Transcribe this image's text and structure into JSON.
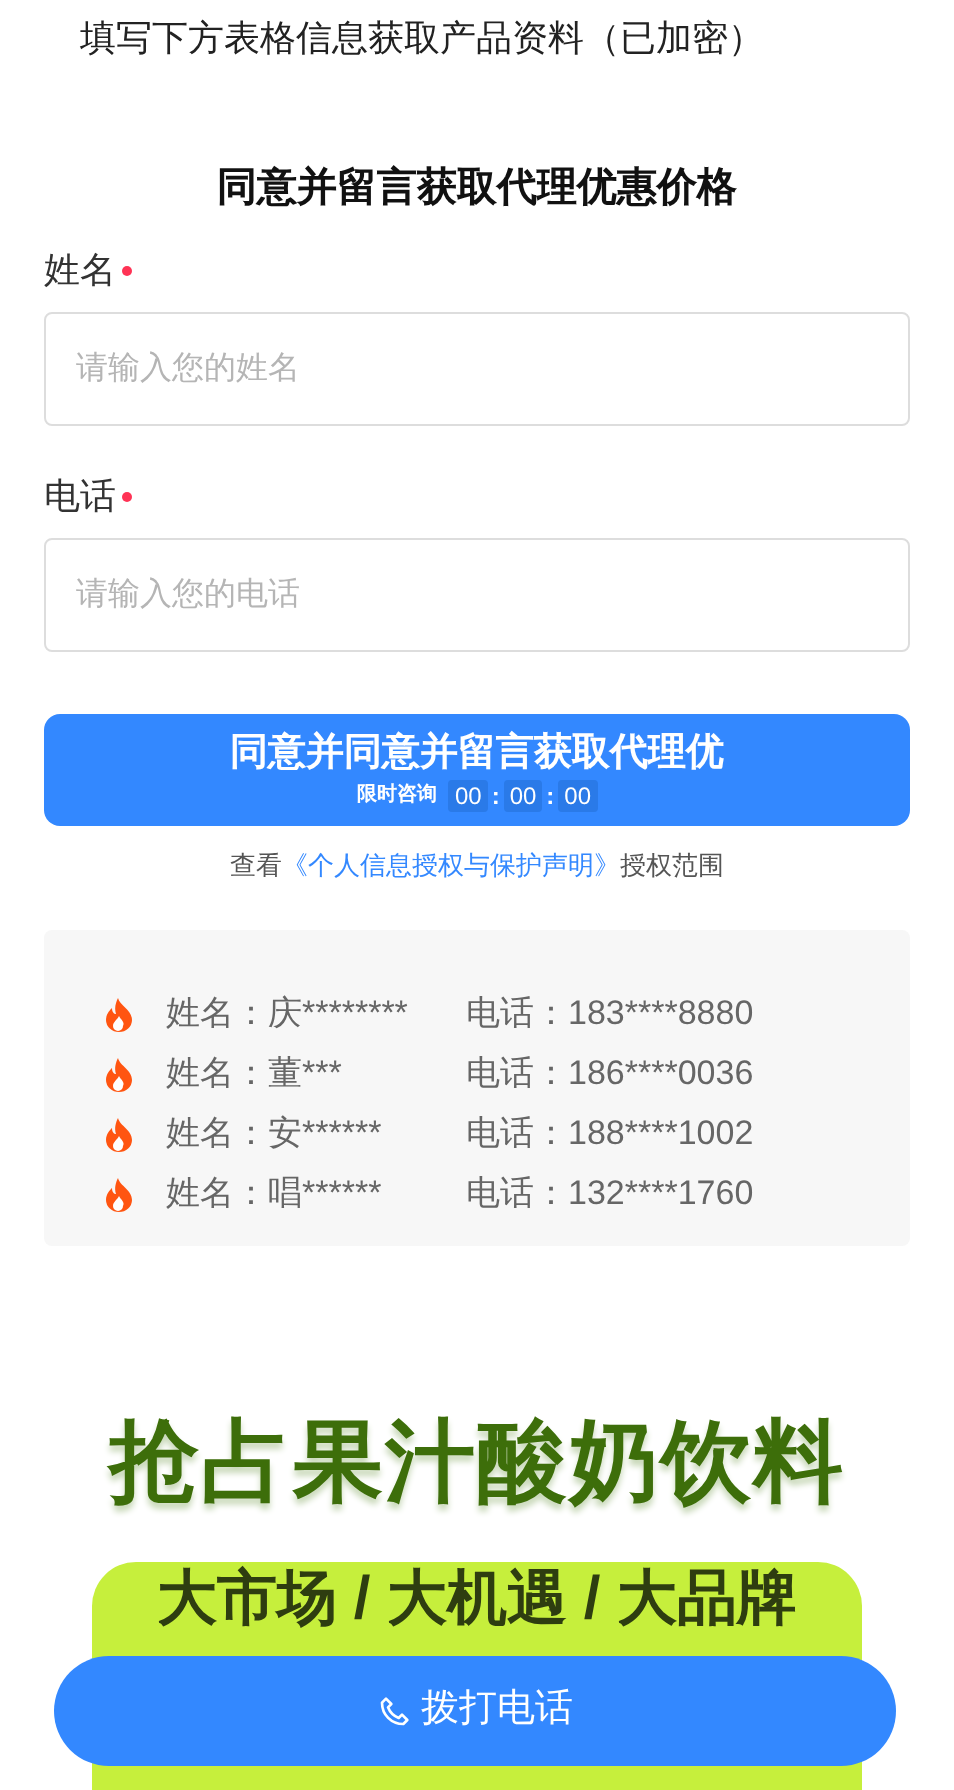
{
  "intro": "填写下方表格信息获取产品资料（已加密）",
  "form": {
    "title": "同意并留言获取代理优惠价格",
    "fields": [
      {
        "label": "姓名",
        "required": true,
        "placeholder": "请输入您的姓名"
      },
      {
        "label": "电话",
        "required": true,
        "placeholder": "请输入您的电话"
      }
    ],
    "submit": {
      "label": "同意并同意并留言获取代理优",
      "timer_label": "限时咨询",
      "timer_parts": [
        {
          "kind": "digits",
          "text": "00"
        },
        {
          "kind": "separator",
          "text": ":"
        },
        {
          "kind": "digits",
          "text": "00"
        },
        {
          "kind": "separator",
          "text": ":"
        },
        {
          "kind": "digits",
          "text": "00"
        }
      ]
    },
    "consent": {
      "prefix": "查看",
      "link": "《个人信息授权与保护声明》",
      "suffix": "授权范围"
    }
  },
  "records": [
    {
      "name": "姓名：庆********",
      "phone": "电话：183****8880"
    },
    {
      "name": "姓名：董***",
      "phone": "电话：186****0036"
    },
    {
      "name": "姓名：安******",
      "phone": "电话：188****1002"
    },
    {
      "name": "姓名：唱******",
      "phone": "电话：132****1760"
    }
  ],
  "banner": {
    "headline": "抢占果汁酸奶饮料",
    "tagline": "大市场 / 大机遇 / 大品牌"
  },
  "call_button": {
    "label": "拨打电话"
  }
}
